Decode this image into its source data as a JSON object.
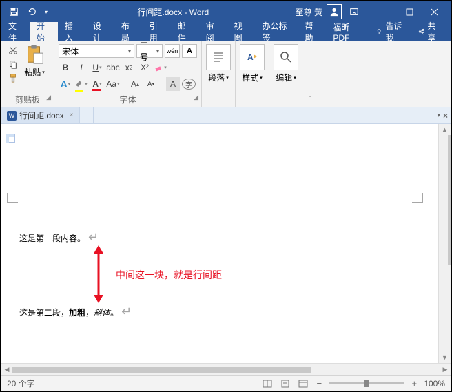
{
  "titlebar": {
    "title": "行间距.docx - Word",
    "user": "至尊 黃"
  },
  "tabs": {
    "file": "文件",
    "home": "开始",
    "insert": "插入",
    "design": "设计",
    "layout": "布局",
    "references": "引用",
    "mailings": "邮件",
    "review": "审阅",
    "view": "视图",
    "officetab": "办公标签",
    "help": "帮助",
    "foxit": "福昕PDF",
    "tellme": "告诉我",
    "share": "共享"
  },
  "ribbon": {
    "clipboard": {
      "label": "剪贴板",
      "paste": "粘贴"
    },
    "font": {
      "label": "字体",
      "name": "宋体",
      "size": "二号",
      "wen": "wén",
      "bold": "B",
      "italic": "I",
      "underline": "U",
      "x2": "X²"
    },
    "paragraph": {
      "label": "段落"
    },
    "styles": {
      "label": "样式"
    },
    "editing": {
      "label": "编辑"
    }
  },
  "doctab": {
    "name": "行间距.docx"
  },
  "document": {
    "line1": "这是第一段内容。",
    "line2_a": "这是第二段，",
    "line2_b": "加粗",
    "line2_c": "，",
    "line2_d": "斜体",
    "line2_e": "。",
    "annotation": "中间这一块，就是行间距"
  },
  "status": {
    "words": "20 个字",
    "zoom": "100%"
  }
}
